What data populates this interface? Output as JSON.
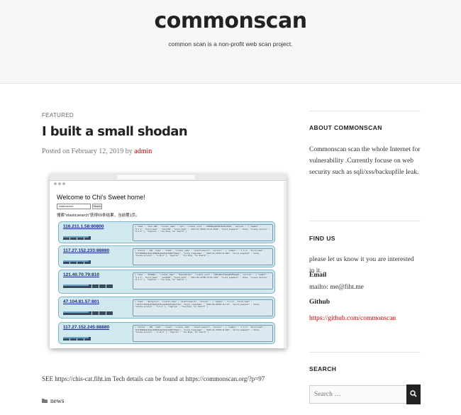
{
  "site": {
    "title": "commonscan",
    "description": "common scan is a non-profit web scan project."
  },
  "post": {
    "featured_label": "FEATURED",
    "title": "I built a small shodan",
    "posted_on": "Posted on",
    "date": "February 12, 2019",
    "by": "by",
    "author": "admin",
    "body": "SEE https://chis-cat.fiht.im Tech details can be found at https://commonscan.org/?p=97",
    "category": "news",
    "screenshot": {
      "heading": "Welcome to Chi's Sweet home!",
      "search_value": "elasticsearch",
      "search_button": "Search",
      "result_info": "搜索\"elasticsearch\"获得69条结果，当前第1页。",
      "results": [
        {
          "ip": "116.211.1.58:80800",
          "json": "{ \"name\" : \"tech-108\", \"cluster_name\" : \"gcs\", \"cluster_uuid\" : \"w6EKNzgAR2SUhkkDCa1S4A\", \"version\" : { \"number\" : \"5.5.1\", \"build_hash\" : \"19c13d0\", \"build_date\" : \"2017-07-18T20:44:24.823Z\", \"build_snapshot\" : false, \"lucene_version\" : \"6.6.0\" }, \"tagline\" : \"You Know, for Search\" }"
        },
        {
          "ip": "117.27.152.233:88880",
          "json": "{ \"status\" : 200, \"name\" : \"node1\", \"cluster_name\" : \"elasticsearch\", \"version\" : { \"number\" : \"1.5.2\", \"build_hash\" : \"62ff9868b4c8a0c45860bebb259e21980778ab1c\", \"build_timestamp\" : \"2015-04-27T09:21:06Z\", \"build_snapshot\" : false, \"lucene_version\" : \"4.10.4\" }, \"tagline\" : \"You Know, for Search\" }"
        },
        {
          "ip": "121.40.70.79:810",
          "json": "{ \"name\" : \"83A8MCi\", \"cluster_name\" : \"MyGoodIndex\", \"cluster_uuid\" : \"QbRn4Wu1T3amgOZzEDaeQA\", \"version\" : { \"number\" : \"5.4.3\", \"build_hash\" : \"eed30a8\", \"build_date\" : \"2017-06-22T00:34:03.743Z\", \"build_snapshot\" : false, \"lucene_version\" : \"6.5.1\" }, \"tagline\" : \"You Know, for Search\" }"
        },
        {
          "ip": "47.104.81.57:801",
          "json": "{ \"name\" : \"Peregrine\", \"cluster_name\" : \"elasticsearch\", \"version\" : { \"number\" : \"2.4.0\", \"build_hash\" : \"ce9f0c7394dee074091dd1bc4e9469251181fc55\", \"build_timestamp\" : \"2016-08-29T09:14:17Z\", \"build_snapshot\" : false, \"lucene_version\" : \"5.5.2\" }, \"tagline\" : \"You Know, for Search\" }"
        },
        {
          "ip": "117.27.152.245:88880",
          "json": "{ \"status\" : 200, \"name\" : \"node1\", \"cluster_name\" : \"elasticsearch\", \"version\" : { \"number\" : \"1.5.2\", \"build_hash\" : \"62ff9868b4c8a0c45860bebb259e21980778ab1c\", \"build_timestamp\" : \"2015-04-27T09:21:06Z\", \"build_snapshot\" : false, \"lucene_version\" : \"4.10.4\" }, \"tagline\" : \"You Know, for Search\" }"
        }
      ]
    }
  },
  "sidebar": {
    "about": {
      "heading": "ABOUT COMMONSCAN",
      "text": "Commonscan scan the whole Internet for vulnerability .Currently focuse on web security such as sqli/xss/backupfile leak."
    },
    "find_us": {
      "heading": "FIND US",
      "text": "please let us know it you are interested in it.",
      "email_label": "Email",
      "email_value": "mailto: me@fiht.me",
      "github_label": "Github",
      "github_link": "https://github.com/commonscan"
    },
    "search": {
      "heading": "SEARCH",
      "placeholder": "Search …"
    }
  },
  "colors": {
    "link": "#cc0000",
    "header_bg": "#f7f7f7",
    "search_button": "#222222"
  }
}
